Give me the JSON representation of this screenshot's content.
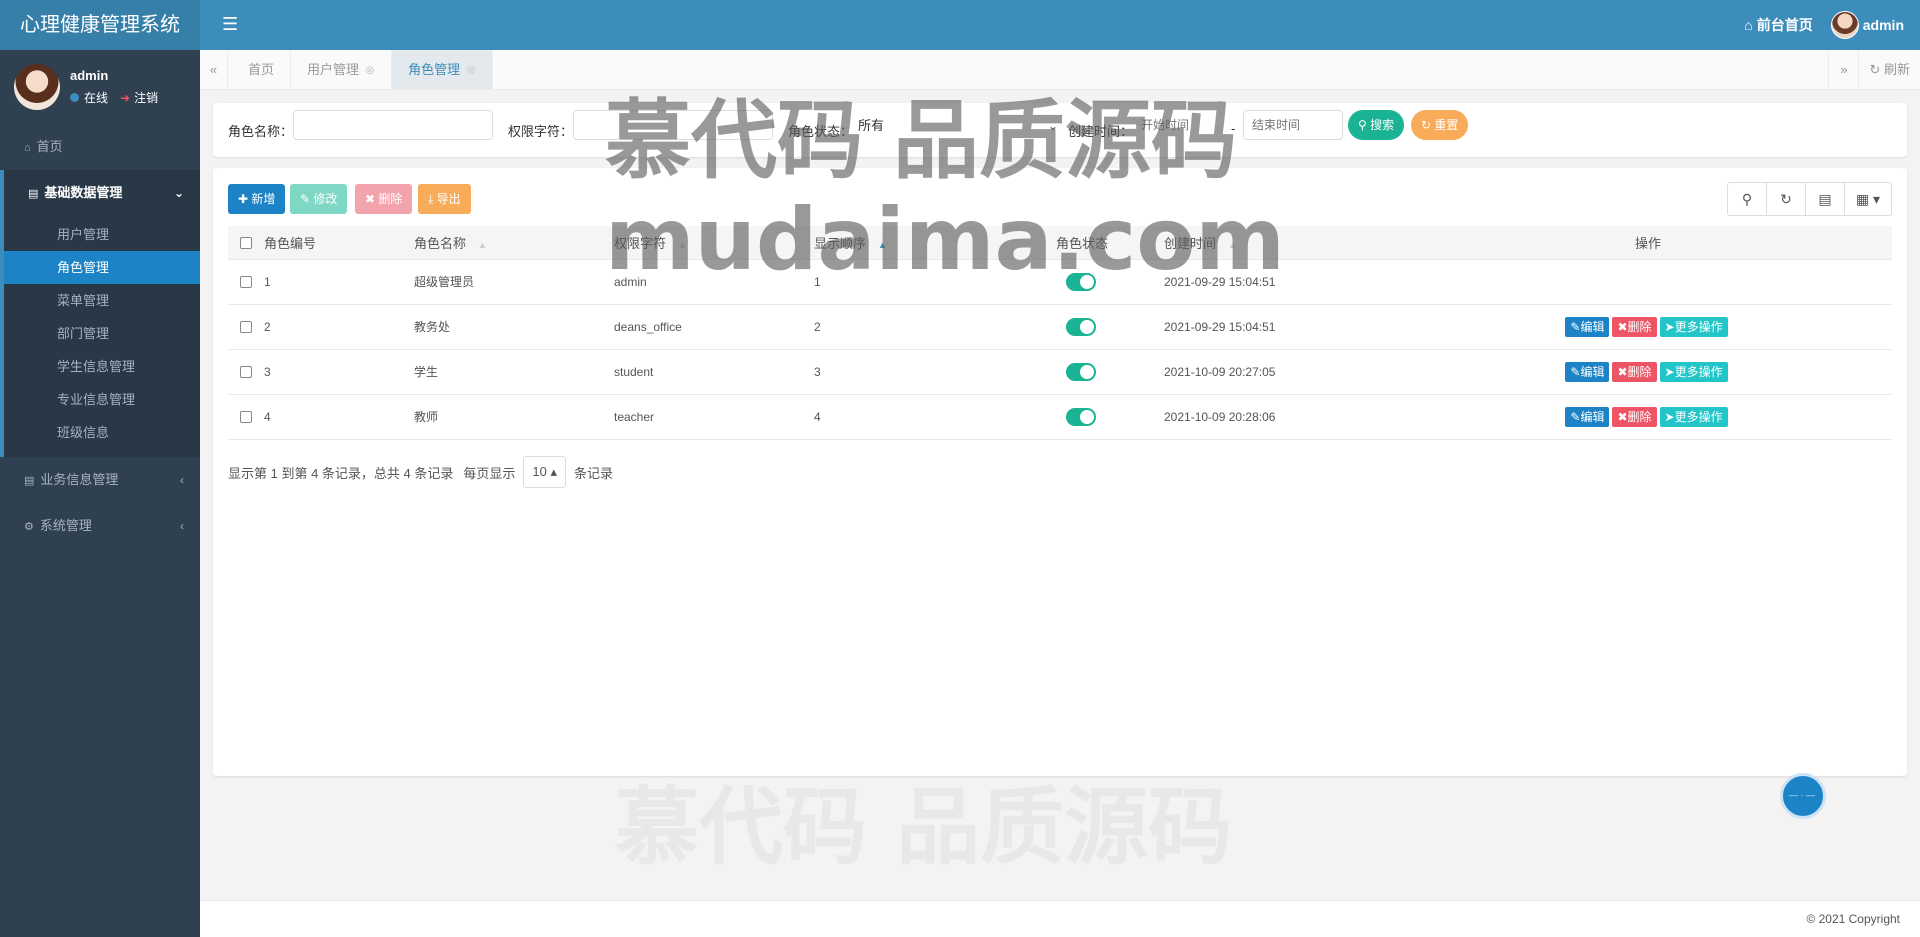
{
  "app": {
    "title": "心理健康管理系统",
    "menu_icon": "hamburger-icon"
  },
  "top_nav": {
    "home_label": "前台首页",
    "user": "admin"
  },
  "user_panel": {
    "name": "admin",
    "status": "在线",
    "logout": "注销"
  },
  "sidebar": {
    "home": "首页",
    "basic": "基础数据管理",
    "basic_items": [
      "用户管理",
      "角色管理",
      "菜单管理",
      "部门管理",
      "学生信息管理",
      "专业信息管理",
      "班级信息"
    ],
    "active_item": "角色管理",
    "business": "业务信息管理",
    "system": "系统管理"
  },
  "tabs": [
    {
      "label": "首页"
    },
    {
      "label": "用户管理"
    },
    {
      "label": "角色管理",
      "active": true
    }
  ],
  "tab_refresh": "刷新",
  "search": {
    "role_name_label": "角色名称：",
    "perm_label": "权限字符：",
    "status_label": "角色状态：",
    "status_value": "所有",
    "time_label": "创建时间：",
    "start_placeholder": "开始时间",
    "dash": "-",
    "end_placeholder": "结束时间",
    "search_btn": "搜索",
    "reset_btn": "重置"
  },
  "toolbar": {
    "add": "新增",
    "edit": "修改",
    "delete": "删除",
    "export": "导出"
  },
  "table": {
    "headers": [
      "角色编号",
      "角色名称",
      "权限字符",
      "显示顺序",
      "角色状态",
      "创建时间",
      "操作"
    ],
    "rows": [
      {
        "id": "1",
        "name": "超级管理员",
        "key": "admin",
        "order": "1",
        "time": "2021-09-29 15:04:51",
        "ops": false
      },
      {
        "id": "2",
        "name": "教务处",
        "key": "deans_office",
        "order": "2",
        "time": "2021-09-29 15:04:51",
        "ops": true
      },
      {
        "id": "3",
        "name": "学生",
        "key": "student",
        "order": "3",
        "time": "2021-10-09 20:27:05",
        "ops": true
      },
      {
        "id": "4",
        "name": "教师",
        "key": "teacher",
        "order": "4",
        "time": "2021-10-09 20:28:06",
        "ops": true
      }
    ],
    "op_edit": "编辑",
    "op_delete": "删除",
    "op_more": "更多操作"
  },
  "pager": {
    "summary": "显示第 1 到第 4 条记录，总共 4 条记录",
    "per_page_prefix": "每页显示",
    "page_size": "10",
    "per_page_suffix": "条记录"
  },
  "watermark": {
    "line1": "慕代码 品质源码",
    "line2": "mudaima.com"
  },
  "footer": {
    "copyright": "© 2021 Copyright"
  },
  "colors": {
    "header": "#3c8dbc",
    "sidebar": "#2f4050",
    "active_blue": "#1c84c6",
    "green": "#1ab394",
    "teal": "#23c6c8",
    "red": "#ed5565",
    "orange": "#f8ac59"
  }
}
